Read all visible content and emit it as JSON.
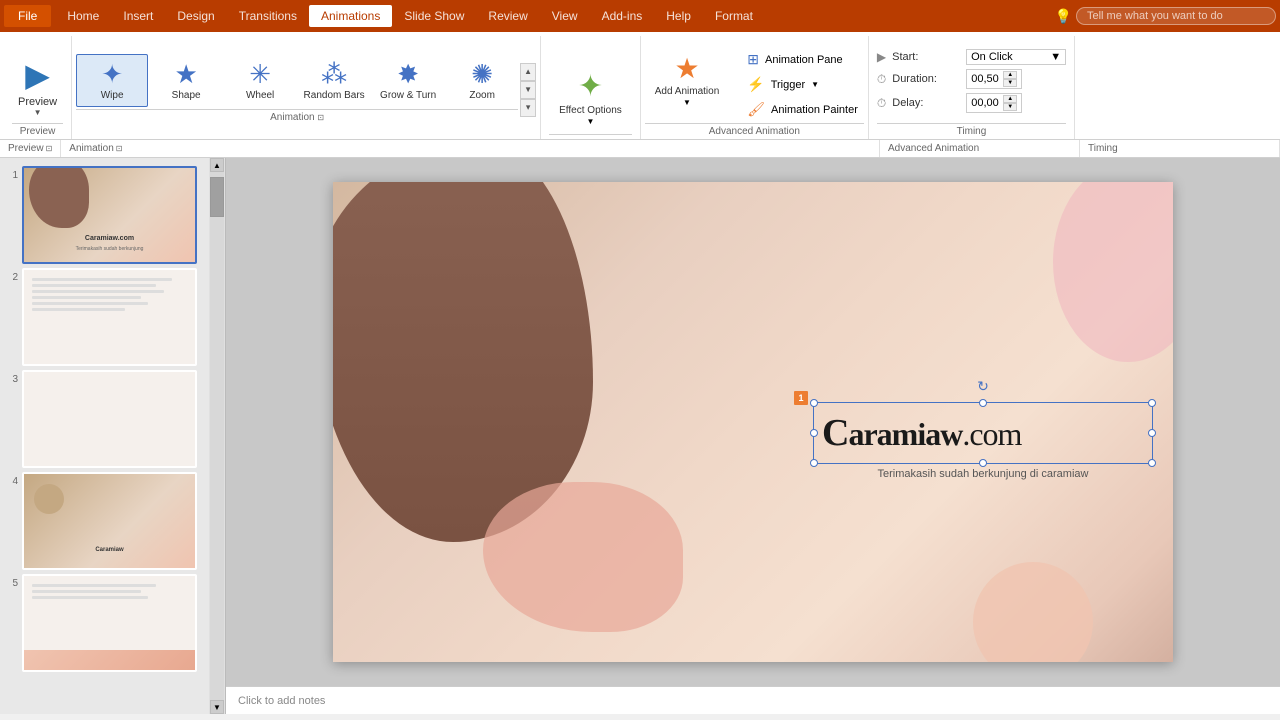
{
  "tabs": {
    "items": [
      "File",
      "Home",
      "Insert",
      "Design",
      "Transitions",
      "Animations",
      "Slide Show",
      "Review",
      "View",
      "Add-ins",
      "Help",
      "Format"
    ],
    "active": "Animations"
  },
  "tell_me": {
    "placeholder": "Tell me what you want to do"
  },
  "ribbon": {
    "preview_label": "Preview",
    "animation_label": "Animation",
    "advanced_animation_label": "Advanced Animation",
    "timing_label": "Timing",
    "animations": [
      {
        "id": "wipe",
        "label": "Wipe",
        "selected": true
      },
      {
        "id": "shape",
        "label": "Shape",
        "selected": false
      },
      {
        "id": "wheel",
        "label": "Wheel",
        "selected": false
      },
      {
        "id": "random-bars",
        "label": "Random Bars",
        "selected": false
      },
      {
        "id": "grow-turn",
        "label": "Grow & Turn",
        "selected": false
      },
      {
        "id": "zoom",
        "label": "Zoom",
        "selected": false
      }
    ],
    "effect_options_label": "Effect Options",
    "animation_pane_label": "Animation Pane",
    "trigger_label": "Trigger",
    "add_animation_label": "Add Animation",
    "animation_painter_label": "Animation Painter",
    "start_label": "Start:",
    "start_value": "On Click",
    "duration_label": "Duration:",
    "duration_value": "00,50",
    "delay_label": "Delay:",
    "delay_value": "00,00"
  },
  "slides": [
    {
      "number": "1",
      "active": true,
      "has_star": true
    },
    {
      "number": "2",
      "active": false,
      "has_star": false
    },
    {
      "number": "3",
      "active": false,
      "has_star": false
    },
    {
      "number": "4",
      "active": false,
      "has_star": false
    },
    {
      "number": "5",
      "active": false,
      "has_star": false
    }
  ],
  "slide_content": {
    "title": "Caramiaw.com",
    "subtitle": "Terimakasih sudah berkunjung di caramiaw",
    "animation_badge": "1"
  },
  "notes": {
    "placeholder": "Click to add notes"
  }
}
